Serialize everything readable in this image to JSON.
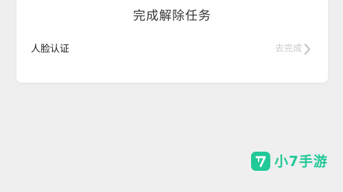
{
  "card": {
    "title": "完成解除任务",
    "task": {
      "name": "人脸认证",
      "action_label": "去完成"
    }
  },
  "watermark": {
    "text": "小7手游",
    "badge_glyph": "7"
  },
  "colors": {
    "background": "#efefef",
    "card": "#ffffff",
    "muted_action": "#c8c8c8",
    "brand_green": "#20c997"
  },
  "icons": {
    "chevron": "chevron-right-icon",
    "logo": "xiao7-logo-icon"
  }
}
